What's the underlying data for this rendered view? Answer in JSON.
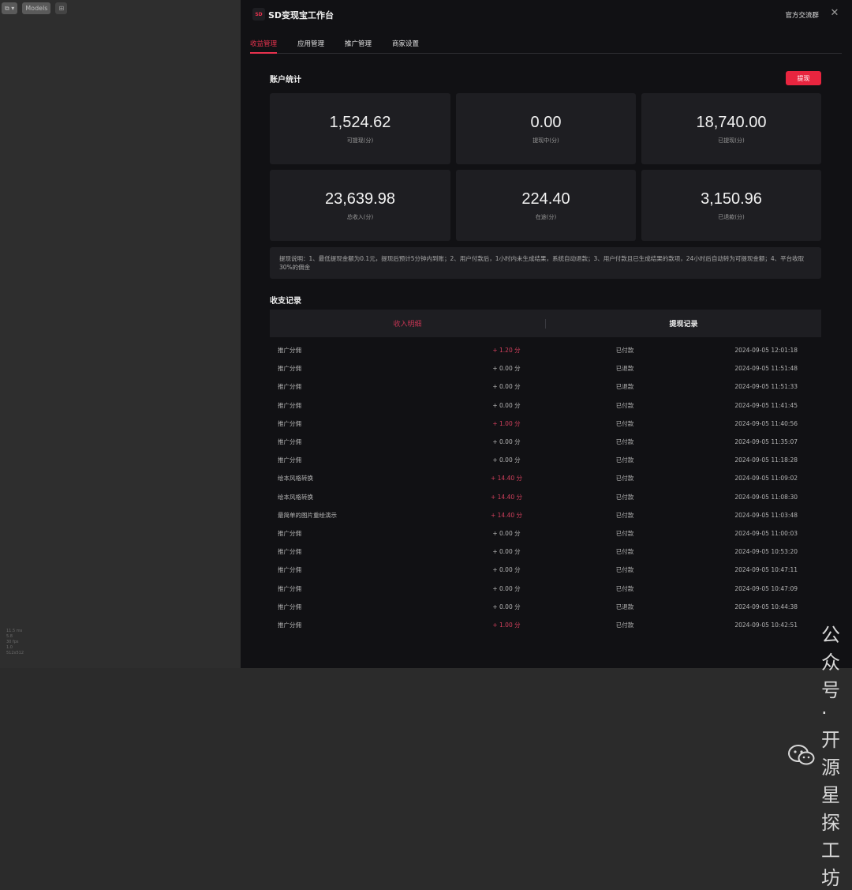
{
  "left_toolbar": {
    "btn1": "⧉ ▾",
    "btn2": "Models",
    "btn3": "⊞"
  },
  "left_bottom_lines": [
    "11.5 ms",
    "5.8",
    "30 fps",
    "1.0",
    "512x512"
  ],
  "header": {
    "logo_text": "SD",
    "title": "SD变现宝工作台",
    "group_link": "官方交流群",
    "close": "✕"
  },
  "tabs": [
    "收益管理",
    "应用管理",
    "推广管理",
    "商家设置"
  ],
  "account": {
    "title": "账户统计",
    "withdraw_label": "提现",
    "stats": [
      {
        "value": "1,524.62",
        "label": "可提现(分)"
      },
      {
        "value": "0.00",
        "label": "提现中(分)"
      },
      {
        "value": "18,740.00",
        "label": "已提现(分)"
      },
      {
        "value": "23,639.98",
        "label": "总收入(分)"
      },
      {
        "value": "224.40",
        "label": "在途(分)"
      },
      {
        "value": "3,150.96",
        "label": "已退款(分)"
      }
    ],
    "note": "提现说明：1、最低提现金额为0.1元，提现后预计5分钟内到账；2、用户付款后，1小时内未生成结果，系统自动退款；3、用户付款且已生成结果的款项，24小时后自动转为可提现金额；4、平台收取30%的佣金"
  },
  "records": {
    "title": "收支记录",
    "tab_income": "收入明细",
    "tab_withdraw": "提现记录",
    "rows": [
      {
        "name": "推广分佣",
        "amount": "+ 1.20 分",
        "status": "已付款",
        "time": "2024-09-05 12:01:18"
      },
      {
        "name": "推广分佣",
        "amount": "+ 0.00 分",
        "status": "已退款",
        "time": "2024-09-05 11:51:48"
      },
      {
        "name": "推广分佣",
        "amount": "+ 0.00 分",
        "status": "已退款",
        "time": "2024-09-05 11:51:33"
      },
      {
        "name": "推广分佣",
        "amount": "+ 0.00 分",
        "status": "已付款",
        "time": "2024-09-05 11:41:45"
      },
      {
        "name": "推广分佣",
        "amount": "+ 1.00 分",
        "status": "已付款",
        "time": "2024-09-05 11:40:56"
      },
      {
        "name": "推广分佣",
        "amount": "+ 0.00 分",
        "status": "已付款",
        "time": "2024-09-05 11:35:07"
      },
      {
        "name": "推广分佣",
        "amount": "+ 0.00 分",
        "status": "已付款",
        "time": "2024-09-05 11:18:28"
      },
      {
        "name": "绘本风格转换",
        "amount": "+ 14.40 分",
        "status": "已付款",
        "time": "2024-09-05 11:09:02"
      },
      {
        "name": "绘本风格转换",
        "amount": "+ 14.40 分",
        "status": "已付款",
        "time": "2024-09-05 11:08:30"
      },
      {
        "name": "最简单的图片重绘演示",
        "amount": "+ 14.40 分",
        "status": "已付款",
        "time": "2024-09-05 11:03:48"
      },
      {
        "name": "推广分佣",
        "amount": "+ 0.00 分",
        "status": "已付款",
        "time": "2024-09-05 11:00:03"
      },
      {
        "name": "推广分佣",
        "amount": "+ 0.00 分",
        "status": "已付款",
        "time": "2024-09-05 10:53:20"
      },
      {
        "name": "推广分佣",
        "amount": "+ 0.00 分",
        "status": "已付款",
        "time": "2024-09-05 10:47:11"
      },
      {
        "name": "推广分佣",
        "amount": "+ 0.00 分",
        "status": "已付款",
        "time": "2024-09-05 10:47:09"
      },
      {
        "name": "推广分佣",
        "amount": "+ 0.00 分",
        "status": "已退款",
        "time": "2024-09-05 10:44:38"
      },
      {
        "name": "推广分佣",
        "amount": "+ 1.00 分",
        "status": "已付款",
        "time": "2024-09-05 10:42:51"
      }
    ]
  },
  "watermark": {
    "text": "公众号 · 开源星探工坊",
    "icon": "wechat-icon"
  }
}
